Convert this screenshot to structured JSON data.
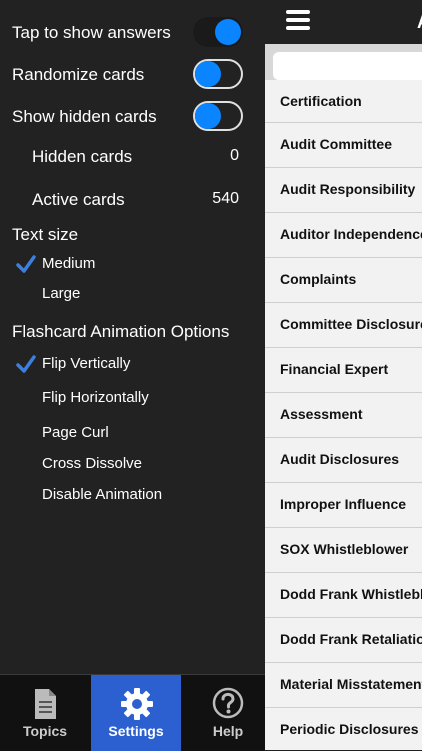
{
  "settings": {
    "toggles": [
      {
        "label": "Tap to show answers",
        "on": true
      },
      {
        "label": "Randomize cards",
        "on": false
      },
      {
        "label": "Show hidden cards",
        "on": false
      }
    ],
    "hidden_cards": {
      "label": "Hidden cards",
      "value": "0"
    },
    "active_cards": {
      "label": "Active cards",
      "value": "540"
    },
    "text_size": {
      "title": "Text size",
      "options": [
        {
          "label": "Medium",
          "checked": true
        },
        {
          "label": "Large",
          "checked": false
        }
      ]
    },
    "animation": {
      "title": "Flashcard Animation Options",
      "options": [
        {
          "label": "Flip Vertically",
          "checked": true
        },
        {
          "label": "Flip Horizontally",
          "checked": false
        },
        {
          "label": "Page Curl",
          "checked": false
        },
        {
          "label": "Cross Dissolve",
          "checked": false
        },
        {
          "label": "Disable Animation",
          "checked": false
        }
      ]
    }
  },
  "tabs": [
    {
      "label": "Topics",
      "icon": "document-icon",
      "active": false
    },
    {
      "label": "Settings",
      "icon": "gear-icon",
      "active": true
    },
    {
      "label": "Help",
      "icon": "question-circle-icon",
      "active": false
    }
  ],
  "right_panel": {
    "title_partial": "A",
    "search": {
      "value": "",
      "placeholder": ""
    },
    "items": [
      "Certification",
      "Audit Committee",
      "Audit Responsibility",
      "Auditor Independence",
      "Complaints",
      "Committee Disclosure",
      "Financial Expert",
      "Assessment",
      "Audit Disclosures",
      "Improper Influence",
      "SOX Whistleblower",
      "Dodd Frank Whistleblower",
      "Dodd Frank Retaliation",
      "Material Misstatement",
      "Periodic Disclosures"
    ]
  },
  "colors": {
    "accent": "#0a84ff",
    "active_tab": "#2c60d0",
    "panel_bg": "#222222",
    "check": "#3d7fe0"
  }
}
